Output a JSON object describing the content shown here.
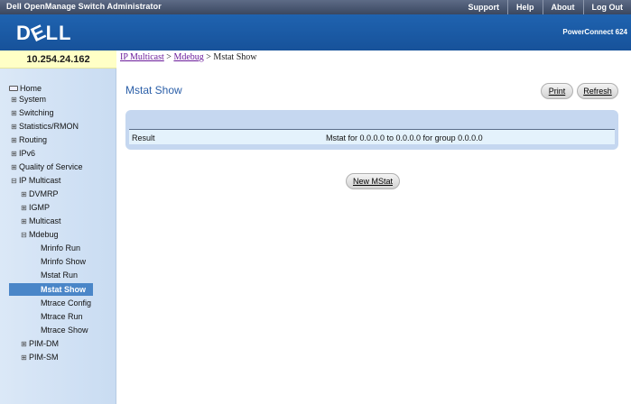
{
  "header": {
    "app_title": "Dell OpenManage Switch Administrator",
    "nav": [
      "Support",
      "Help",
      "About",
      "Log Out"
    ],
    "logo": "DELL",
    "product": "PowerConnect 624"
  },
  "device": {
    "ip": "10.254.24.162"
  },
  "breadcrumb": {
    "items": [
      {
        "label": "IP Multicast",
        "link": true
      },
      {
        "label": "Mdebug",
        "link": true
      },
      {
        "label": "Mstat Show",
        "link": false
      }
    ],
    "separator": ">"
  },
  "sidebar": {
    "items": [
      {
        "label": "Home",
        "icon": "home-icon",
        "level": 0
      },
      {
        "label": "System",
        "icon": "expand-icon",
        "level": 0
      },
      {
        "label": "Switching",
        "icon": "expand-icon",
        "level": 0
      },
      {
        "label": "Statistics/RMON",
        "icon": "expand-icon",
        "level": 0
      },
      {
        "label": "Routing",
        "icon": "expand-icon",
        "level": 0
      },
      {
        "label": "IPv6",
        "icon": "expand-icon",
        "level": 0
      },
      {
        "label": "Quality of Service",
        "icon": "expand-icon",
        "level": 0
      },
      {
        "label": "IP Multicast",
        "icon": "collapse-icon",
        "level": 0
      },
      {
        "label": "DVMRP",
        "icon": "expand-icon",
        "level": 1
      },
      {
        "label": "IGMP",
        "icon": "expand-icon",
        "level": 1
      },
      {
        "label": "Multicast",
        "icon": "expand-icon",
        "level": 1
      },
      {
        "label": "Mdebug",
        "icon": "collapse-icon",
        "level": 1
      },
      {
        "label": "Mrinfo Run",
        "icon": "",
        "level": 2
      },
      {
        "label": "Mrinfo Show",
        "icon": "",
        "level": 2
      },
      {
        "label": "Mstat Run",
        "icon": "",
        "level": 2
      },
      {
        "label": "Mstat Show",
        "icon": "",
        "level": 2,
        "selected": true
      },
      {
        "label": "Mtrace Config",
        "icon": "",
        "level": 2
      },
      {
        "label": "Mtrace Run",
        "icon": "",
        "level": 2
      },
      {
        "label": "Mtrace Show",
        "icon": "",
        "level": 2
      },
      {
        "label": "PIM-DM",
        "icon": "expand-icon",
        "level": 1
      },
      {
        "label": "PIM-SM",
        "icon": "expand-icon",
        "level": 1
      }
    ]
  },
  "main": {
    "title": "Mstat Show",
    "print_label": "Print",
    "refresh_label": "Refresh",
    "result_label": "Result",
    "result_value": "Mstat for 0.0.0.0 to 0.0.0.0 for group 0.0.0.0",
    "new_button_label": "New MStat"
  },
  "colors": {
    "banner": "#1f63b0",
    "topbar": "#3a4760",
    "sidebar": "#d4e3f5",
    "selected": "#4a86c8",
    "title": "#2b5fa8",
    "panel": "#c5d7f0"
  }
}
